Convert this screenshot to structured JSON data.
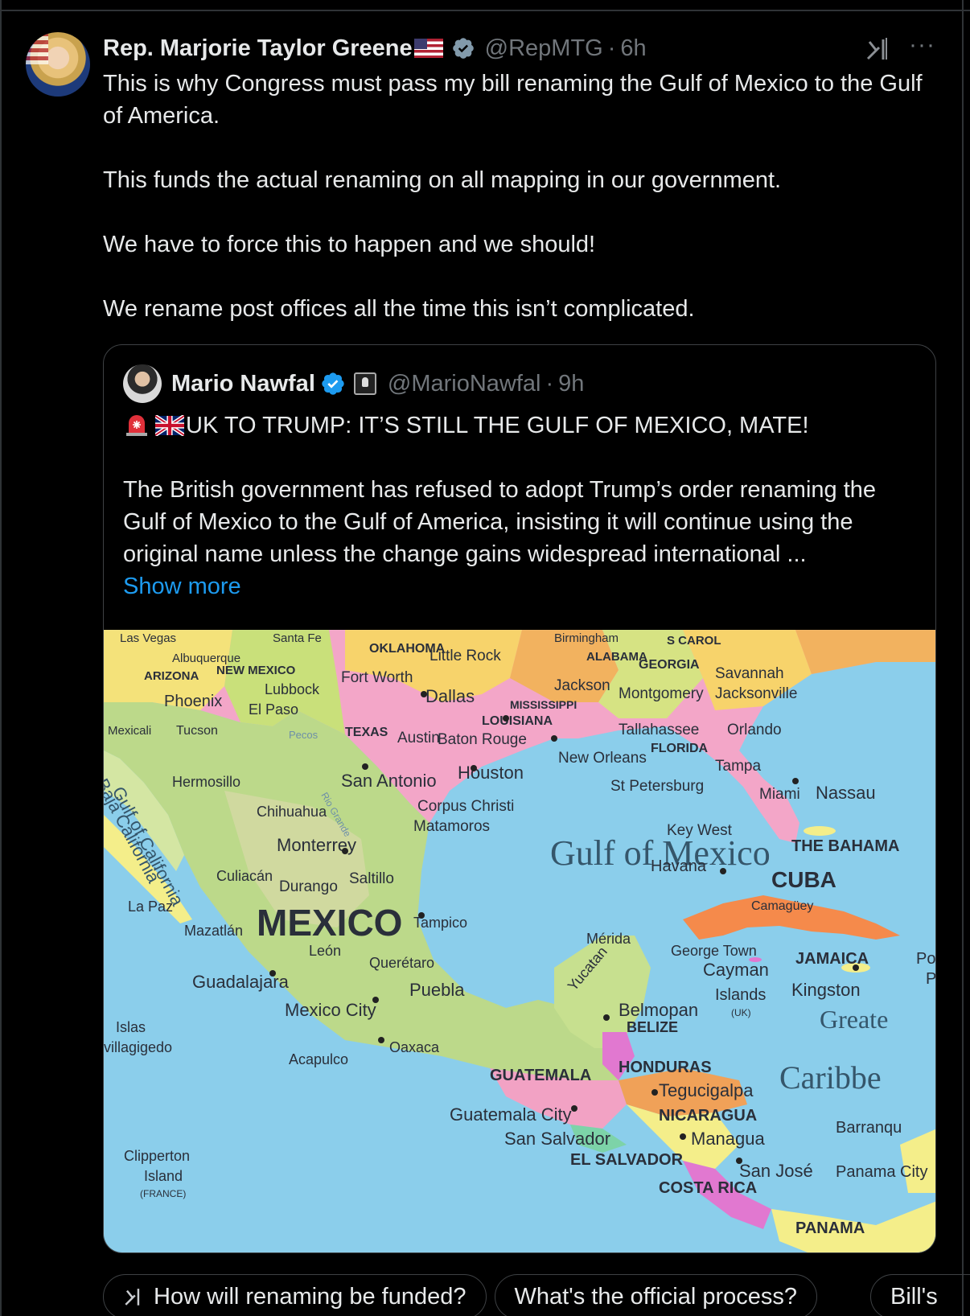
{
  "post": {
    "author_name": "Rep. Marjorie Taylor Greene",
    "handle": "@RepMTG",
    "separator": "·",
    "time": "6h",
    "text": [
      "This is why Congress must pass my bill renaming the Gulf of Mexico to the Gulf of America.",
      "This funds the actual renaming on all mapping in our government.",
      "We have to force this to happen and we should!",
      "We rename post offices all the time this isn’t complicated."
    ]
  },
  "quoted": {
    "author_name": "Mario Nawfal",
    "handle": "@MarioNawfal",
    "separator": "·",
    "time": "9h",
    "headline": "UK TO TRUMP: IT’S STILL THE GULF OF MEXICO, MATE!",
    "body": "The British government has refused to adopt Trump’s order renaming the Gulf of Mexico to the Gulf of America, insisting it will continue using the original name unless the change gains widespread international ...",
    "show_more": "Show more",
    "map_labels": {
      "gulf": "Gulf of Mexico",
      "mexico": "MEXICO",
      "texas": "TEXAS",
      "oklahoma": "OKLAHOMA",
      "alabama": "ALABAMA",
      "georgia": "GEORGIA",
      "mississippi": "MISSISSIPPI",
      "louisiana": "LOUISIANA",
      "florida": "FLORIDA",
      "arizona": "ARIZONA",
      "new_mexico": "NEW MEXICO",
      "cuba": "CUBA",
      "bahamas": "THE BAHAMA",
      "jamaica": "JAMAICA",
      "belize": "BELIZE",
      "guatemala": "GUATEMALA",
      "honduras": "HONDURAS",
      "nicaragua": "NICARAGUA",
      "el_salvador": "EL SALVADOR",
      "costa_rica": "COSTA RICA",
      "panama": "PANAMA",
      "caribbean": "Caribbe",
      "greater": "Greate",
      "gulf_california": "Gulf of California",
      "baja": "Baja California",
      "dallas": "Dallas",
      "fort_worth": "Fort Worth",
      "little_rock": "Little Rock",
      "houston": "Houston",
      "san_antonio": "San Antonio",
      "austin": "Austin",
      "baton_rouge": "Baton Rouge",
      "new_orleans": "New Orleans",
      "jackson": "Jackson",
      "montgomery": "Montgomery",
      "tallahassee": "Tallahassee",
      "savannah": "Savannah",
      "jacksonville": "Jacksonville",
      "orlando": "Orlando",
      "tampa": "Tampa",
      "st_petersburg": "St Petersburg",
      "miami": "Miami",
      "nassau": "Nassau",
      "key_west": "Key West",
      "havana": "Havana",
      "camaguey": "Camagüey",
      "corpus_christi": "Corpus Christi",
      "matamoros": "Matamoros",
      "monterrey": "Monterrey",
      "saltillo": "Saltillo",
      "chihuahua": "Chihuahua",
      "hermosillo": "Hermosillo",
      "culiacan": "Culiacán",
      "durango": "Durango",
      "mazatlan": "Mazatlán",
      "la_paz": "La Paz",
      "tampico": "Tampico",
      "leon": "León",
      "queretaro": "Querétaro",
      "guadalajara": "Guadalajara",
      "mexico_city": "Mexico City",
      "puebla": "Puebla",
      "oaxaca": "Oaxaca",
      "acapulco": "Acapulco",
      "merida": "Mérida",
      "yucatan": "Yucatan",
      "belmopan": "Belmopan",
      "george_town": "George Town",
      "cayman": "Cayman",
      "islands": "Islands",
      "uk": "(UK)",
      "kingston": "Kingston",
      "tegucigalpa": "Tegucigalpa",
      "guatemala_city": "Guatemala City",
      "san_salvador": "San Salvador",
      "managua": "Managua",
      "san_jose": "San José",
      "panama_city": "Panama City",
      "barranquilla": "Barranqu",
      "lubbock": "Lubbock",
      "el_paso": "El Paso",
      "phoenix": "Phoenix",
      "tucson": "Tucson",
      "albuquerque": "Albuquerque",
      "santa_fe": "Santa Fe",
      "las_vegas": "Las Vegas",
      "mexicali": "Mexicali",
      "birmingham": "Birmingham",
      "s_carolina": "S CAROL",
      "islas": "Islas",
      "revillagigedo": "villagigedo",
      "clipperton": "Clipperton",
      "island": "Island",
      "france": "(FRANCE)",
      "pecos": "Pecos",
      "rio_grande": "Rio Grande",
      "po": "Po",
      "p": "P"
    }
  },
  "chips": [
    "How will renaming be funded?",
    "What's the official process?",
    "Bill's"
  ],
  "colors": {
    "background": "#000000",
    "text": "#e7e9ea",
    "muted": "#71767b",
    "link": "#1d9bf0",
    "border": "#3e4144",
    "verified": "#1d9bf0"
  },
  "icons": [
    "us-flag-icon",
    "verified-badge-icon",
    "grok-icon",
    "more-icon",
    "siren-icon",
    "uk-flag-icon",
    "org-badge-icon"
  ]
}
